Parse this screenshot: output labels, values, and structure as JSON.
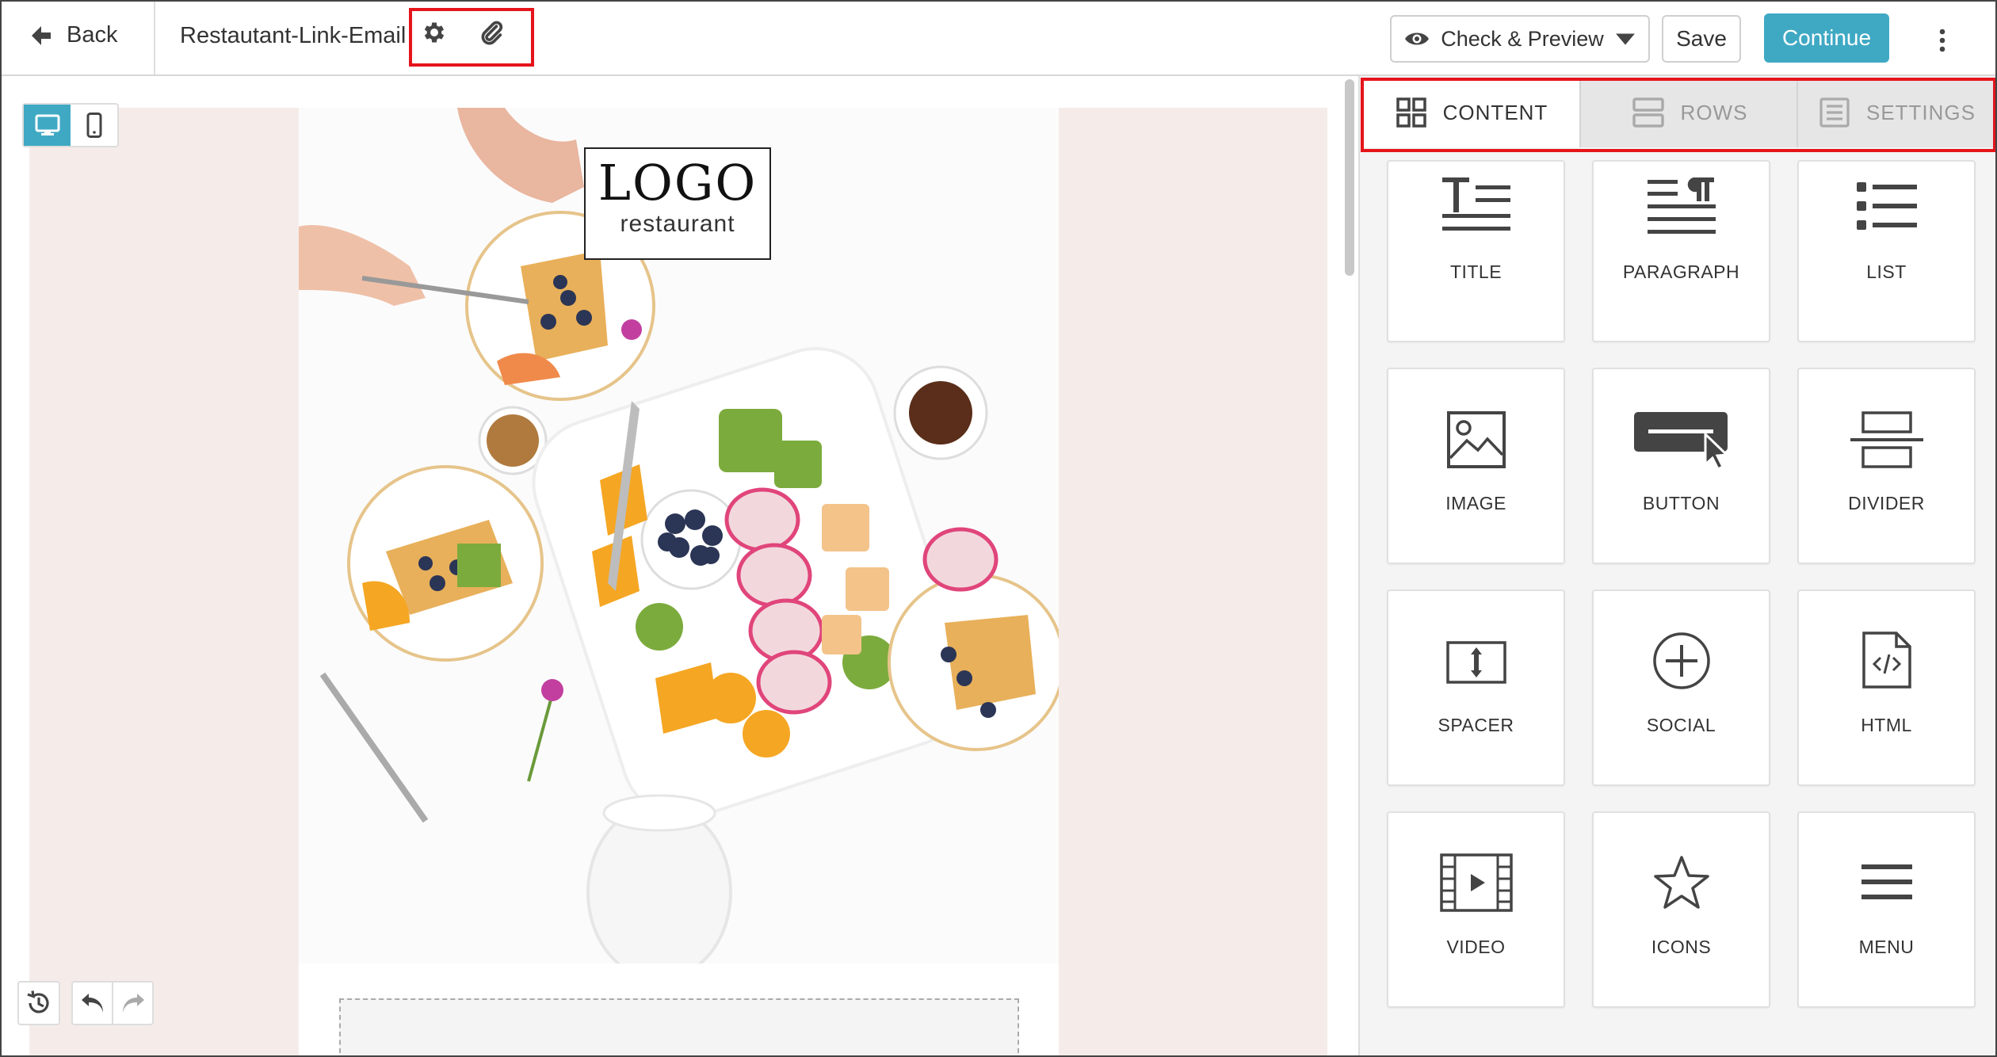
{
  "header": {
    "back_label": "Back",
    "document_title": "Restautant-Link-Email",
    "check_preview_label": "Check & Preview",
    "save_label": "Save",
    "continue_label": "Continue"
  },
  "canvas": {
    "logo_text": "LOGO",
    "logo_subtext": "restaurant"
  },
  "panel": {
    "tabs": [
      {
        "label": "CONTENT",
        "active": true
      },
      {
        "label": "ROWS",
        "active": false
      },
      {
        "label": "SETTINGS",
        "active": false
      }
    ],
    "blocks": [
      {
        "label": "TITLE",
        "icon": "title-icon"
      },
      {
        "label": "PARAGRAPH",
        "icon": "paragraph-icon"
      },
      {
        "label": "LIST",
        "icon": "list-icon"
      },
      {
        "label": "IMAGE",
        "icon": "image-icon"
      },
      {
        "label": "BUTTON",
        "icon": "button-icon"
      },
      {
        "label": "DIVIDER",
        "icon": "divider-icon"
      },
      {
        "label": "SPACER",
        "icon": "spacer-icon"
      },
      {
        "label": "SOCIAL",
        "icon": "social-icon"
      },
      {
        "label": "HTML",
        "icon": "html-icon"
      },
      {
        "label": "VIDEO",
        "icon": "video-icon"
      },
      {
        "label": "ICONS",
        "icon": "star-icon"
      },
      {
        "label": "MENU",
        "icon": "menu-icon"
      }
    ]
  },
  "colors": {
    "accent": "#3fa9c4",
    "highlight": "#e5141b",
    "page_background": "#f5ecea"
  }
}
